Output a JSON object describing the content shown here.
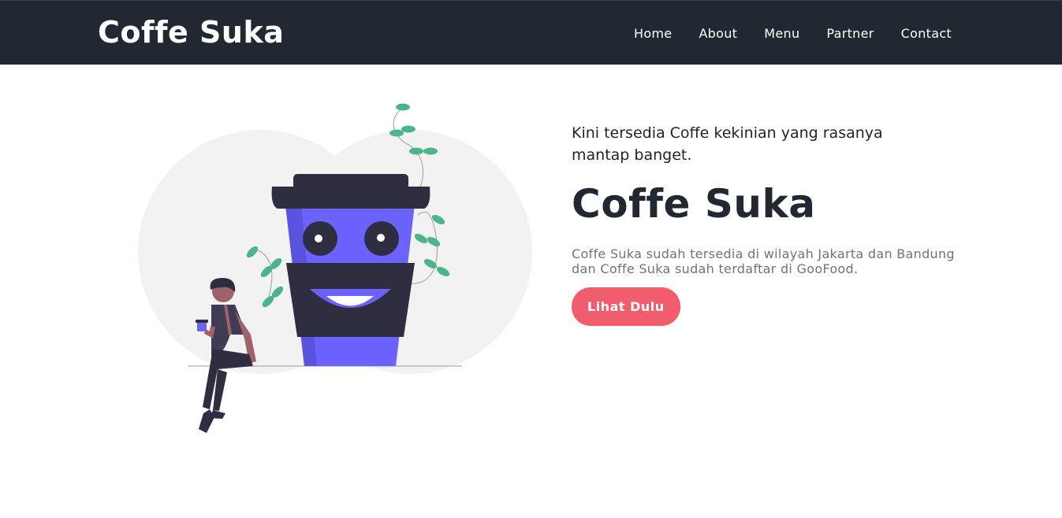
{
  "navbar": {
    "brand": "Coffe Suka",
    "links": [
      "Home",
      "About",
      "Menu",
      "Partner",
      "Contact"
    ]
  },
  "hero": {
    "tagline": "Kini tersedia Coffe kekinian yang rasanya mantap banget.",
    "title": "Coffe Suka",
    "description": "Coffe Suka sudah tersedia di wilayah Jakarta dan Bandung dan Coffe Suka sudah terdaftar di GooFood.",
    "cta_label": "Lihat Dulu",
    "illustration_icon": "coffee-cup-character-illustration"
  },
  "colors": {
    "navbar_bg": "#212832",
    "accent": "#f25d6e",
    "cup_body": "#6c63ff",
    "cup_lid": "#2f2e41",
    "leaf": "#4bb589"
  }
}
